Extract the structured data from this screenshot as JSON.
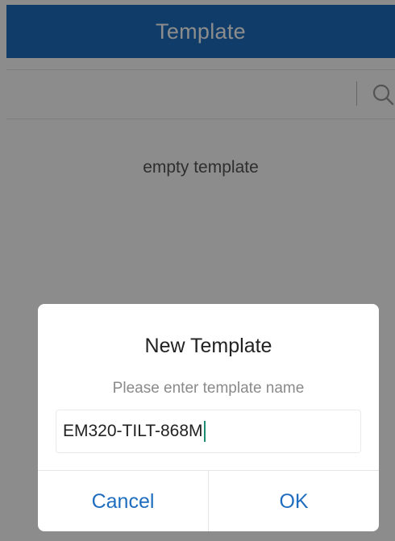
{
  "header": {
    "title": "Template"
  },
  "search": {
    "icon": "search-icon"
  },
  "list": {
    "empty_text": "empty template"
  },
  "dialog": {
    "title": "New Template",
    "prompt": "Please enter template name",
    "input_value": "EM320-TILT-868M",
    "cancel_label": "Cancel",
    "ok_label": "OK"
  },
  "colors": {
    "header_bg": "#1e6dbf",
    "accent": "#1e6dbf",
    "caret": "#1d8a74"
  }
}
